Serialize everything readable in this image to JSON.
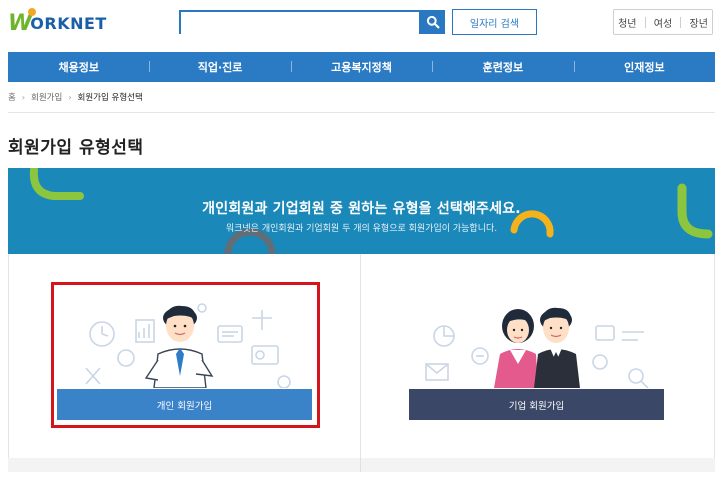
{
  "header": {
    "logo_letter": "W",
    "logo_text": "ORKNET",
    "search": {
      "value": "",
      "placeholder": ""
    },
    "search_icon": "search-icon",
    "job_search_label": "일자리 검색",
    "quick_links": [
      "청년",
      "여성",
      "장년"
    ]
  },
  "nav": {
    "items": [
      "채용정보",
      "직업·진로",
      "고용복지정책",
      "훈련정보",
      "인재정보"
    ]
  },
  "breadcrumb": {
    "home_icon": "home-icon",
    "home": "홈",
    "items": [
      "회원가입",
      "회원가입 유형선택"
    ]
  },
  "page": {
    "title": "회원가입 유형선택"
  },
  "banner": {
    "title": "개인회원과 기업회원 중 원하는 유형을 선택해주세요.",
    "subtitle": "워크넷은 개인회원과 기업회원 두 개의 유형으로 회원가입이 가능합니다."
  },
  "options": {
    "personal": {
      "label": "개인 회원가입"
    },
    "corporate": {
      "label": "기업 회원가입"
    }
  },
  "colors": {
    "brand_blue": "#2a7ac4",
    "banner_teal": "#1a88b8",
    "personal_button": "#3a83c9",
    "corporate_button": "#3b4766",
    "highlight_red": "#d4161c",
    "logo_green": "#6fb52c"
  }
}
